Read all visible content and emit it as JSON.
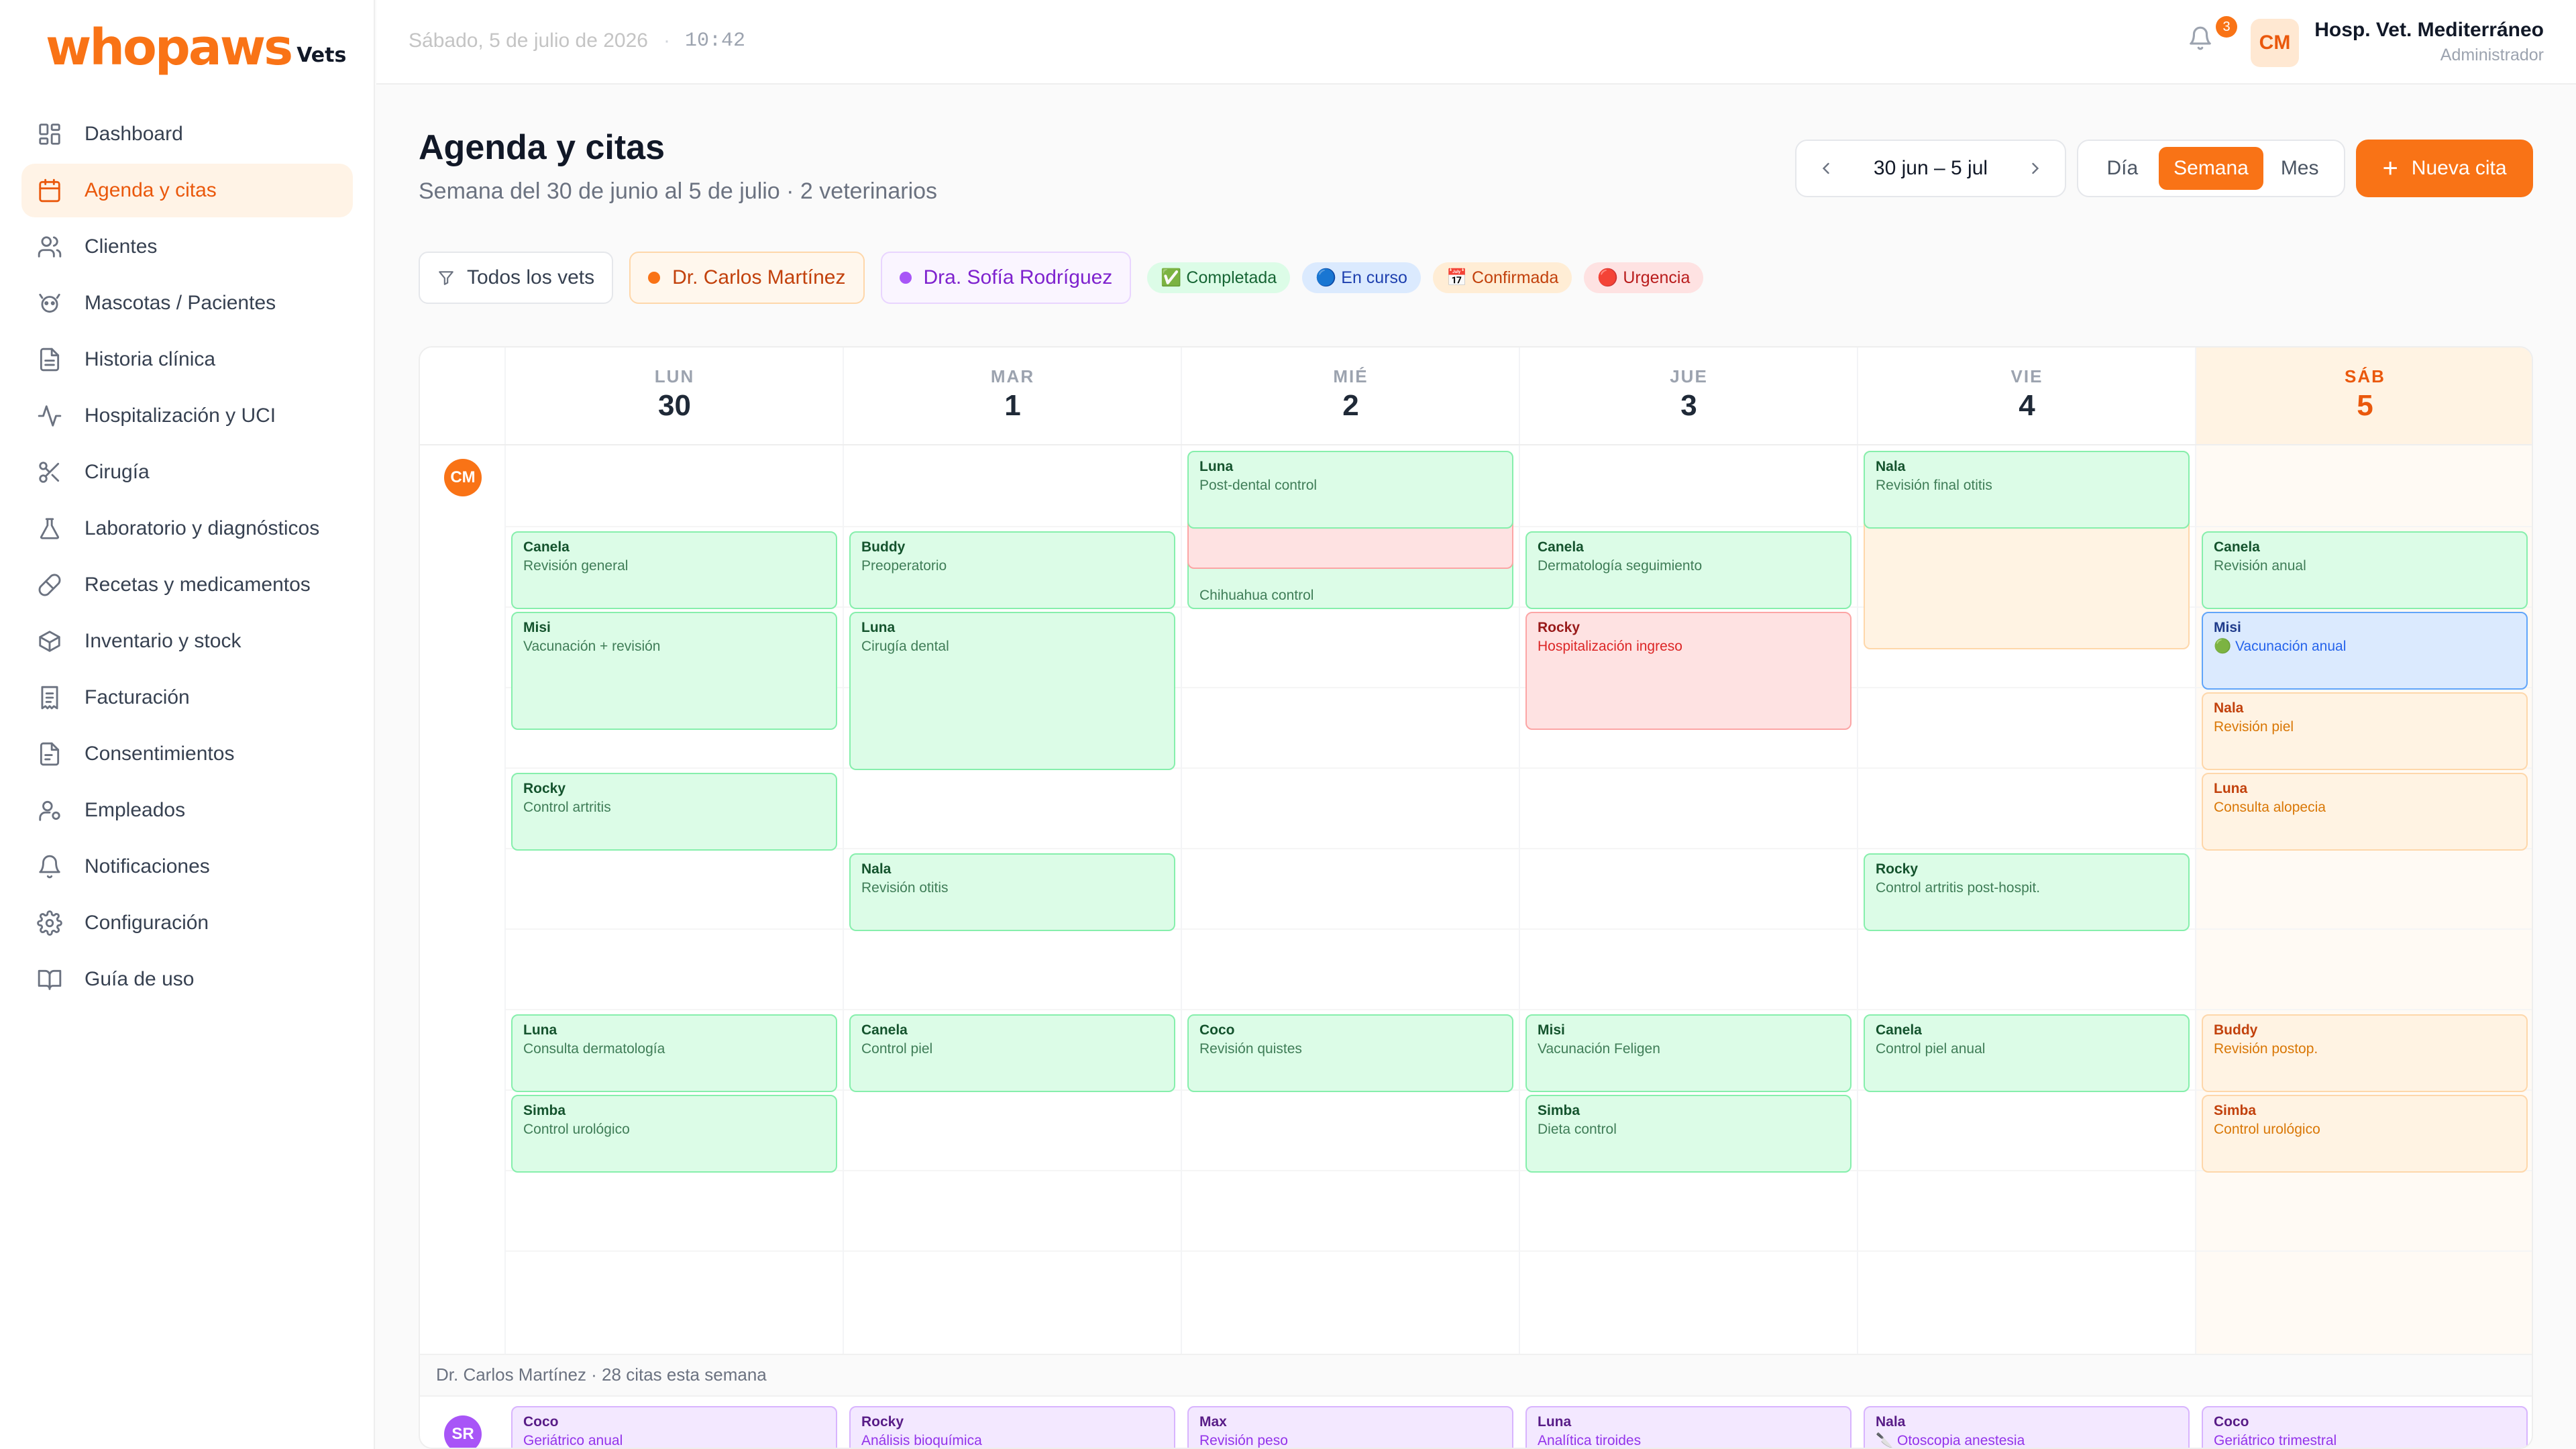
{
  "brand": {
    "name": "whopaws",
    "sub": "Vets",
    "accent": "#f97316"
  },
  "sidebar": {
    "items": [
      {
        "label": "Dashboard",
        "icon": "dashboard-icon",
        "active": false
      },
      {
        "label": "Agenda y citas",
        "icon": "calendar-icon",
        "active": true
      },
      {
        "label": "Clientes",
        "icon": "users-icon",
        "active": false
      },
      {
        "label": "Mascotas / Pacientes",
        "icon": "paw-icon",
        "active": false
      },
      {
        "label": "Historia clínica",
        "icon": "file-icon",
        "active": false
      },
      {
        "label": "Hospitalización y UCI",
        "icon": "pulse-icon",
        "active": false
      },
      {
        "label": "Cirugía",
        "icon": "scissors-icon",
        "active": false
      },
      {
        "label": "Laboratorio y diagnósticos",
        "icon": "flask-icon",
        "active": false
      },
      {
        "label": "Recetas y medicamentos",
        "icon": "pill-icon",
        "active": false
      },
      {
        "label": "Inventario y stock",
        "icon": "box-icon",
        "active": false
      },
      {
        "label": "Facturación",
        "icon": "receipt-icon",
        "active": false
      },
      {
        "label": "Consentimientos",
        "icon": "document-icon",
        "active": false
      },
      {
        "label": "Empleados",
        "icon": "employee-icon",
        "active": false
      },
      {
        "label": "Notificaciones",
        "icon": "bell-icon",
        "active": false
      },
      {
        "label": "Configuración",
        "icon": "gear-icon",
        "active": false
      },
      {
        "label": "Guía de uso",
        "icon": "book-icon",
        "active": false
      }
    ]
  },
  "topbar": {
    "date": "Sábado, 5 de julio de 2026",
    "separator": "·",
    "time": "10:42",
    "notifications_count": "3",
    "avatar": "CM",
    "org_name": "Hosp. Vet. Mediterráneo",
    "role": "Administrador"
  },
  "header": {
    "title": "Agenda y citas",
    "subtitle": "Semana del 30 de junio al 5 de julio · 2 veterinarios",
    "range": "30 jun – 5 jul",
    "views": [
      "Día",
      "Semana",
      "Mes"
    ],
    "active_view": "Semana",
    "new_button": "Nueva cita"
  },
  "filters": {
    "all": "Todos los vets",
    "vets": [
      {
        "name": "Dr. Carlos Martínez",
        "color": "#f97316"
      },
      {
        "name": "Dra. Sofía Rodríguez",
        "color": "#a855f7"
      }
    ],
    "legend": [
      {
        "label": "✅ Completada",
        "bg": "#dcfce7",
        "fg": "#166534"
      },
      {
        "label": "🔵 En curso",
        "bg": "#dbeafe",
        "fg": "#1e40af"
      },
      {
        "label": "📅 Confirmada",
        "bg": "#ffedd5",
        "fg": "#c2410c"
      },
      {
        "label": "🔴 Urgencia",
        "bg": "#fee2e2",
        "fg": "#b91c1c"
      }
    ]
  },
  "calendar": {
    "days": [
      {
        "dow": "LUN",
        "num": "30",
        "today": false
      },
      {
        "dow": "MAR",
        "num": "1",
        "today": false
      },
      {
        "dow": "MIÉ",
        "num": "2",
        "today": false
      },
      {
        "dow": "JUE",
        "num": "3",
        "today": false
      },
      {
        "dow": "VIE",
        "num": "4",
        "today": false
      },
      {
        "dow": "SÁB",
        "num": "5",
        "today": true
      }
    ],
    "vet1": {
      "avatar": "CM",
      "color": "#f97316",
      "summary": "Dr. Carlos Martínez · 28 citas esta semana",
      "appointments": [
        {
          "day": 0,
          "slot": 1,
          "span": 1,
          "pet": "Canela",
          "reason": "Revisión general",
          "status": "completada"
        },
        {
          "day": 0,
          "slot": 2,
          "span": 1.5,
          "pet": "Misi",
          "reason": "Vacunación + revisión",
          "status": "completada"
        },
        {
          "day": 0,
          "slot": 4,
          "span": 1,
          "pet": "Rocky",
          "reason": "Control artritis",
          "status": "completada"
        },
        {
          "day": 0,
          "slot": 7,
          "span": 1,
          "pet": "Luna",
          "reason": "Consulta dermatología",
          "status": "completada"
        },
        {
          "day": 0,
          "slot": 8,
          "span": 1,
          "pet": "Simba",
          "reason": "Control urológico",
          "status": "completada"
        },
        {
          "day": 1,
          "slot": 1,
          "span": 1,
          "pet": "Buddy",
          "reason": "Preoperatorio",
          "status": "completada"
        },
        {
          "day": 1,
          "slot": 2,
          "span": 2,
          "pet": "Luna",
          "reason": "Cirugía dental",
          "status": "completada"
        },
        {
          "day": 1,
          "slot": 5,
          "span": 1,
          "pet": "Nala",
          "reason": "Revisión otitis",
          "status": "completada"
        },
        {
          "day": 1,
          "slot": 7,
          "span": 1,
          "pet": "Canela",
          "reason": "Control piel",
          "status": "completada"
        },
        {
          "day": 2,
          "slot": 1,
          "span": 1,
          "pet": "",
          "reason": "Chihuahua control",
          "status": "completada"
        },
        {
          "day": 2,
          "slot": 0.5,
          "span": 1,
          "pet": "",
          "reason": "",
          "status": "urgencia"
        },
        {
          "day": 2,
          "slot": 0,
          "span": 1,
          "pet": "Luna",
          "reason": "Post-dental control",
          "status": "completada"
        },
        {
          "day": 2,
          "slot": 7,
          "span": 1,
          "pet": "Coco",
          "reason": "Revisión quistes",
          "status": "completada"
        },
        {
          "day": 3,
          "slot": 1,
          "span": 1,
          "pet": "Canela",
          "reason": "Dermatología seguimiento",
          "status": "completada"
        },
        {
          "day": 3,
          "slot": 2,
          "span": 1.5,
          "pet": "Rocky",
          "reason": "Hospitalización ingreso",
          "status": "urgencia"
        },
        {
          "day": 3,
          "slot": 7,
          "span": 1,
          "pet": "Misi",
          "reason": "Vacunación Feligen",
          "status": "completada"
        },
        {
          "day": 3,
          "slot": 8,
          "span": 1,
          "pet": "Simba",
          "reason": "Dieta control",
          "status": "completada"
        },
        {
          "day": 4,
          "slot": 0,
          "span": 2.5,
          "pet": "",
          "reason": "",
          "status": "confirmada"
        },
        {
          "day": 4,
          "slot": 0,
          "span": 1,
          "pet": "Nala",
          "reason": "Revisión final otitis",
          "status": "completada"
        },
        {
          "day": 4,
          "slot": 5,
          "span": 1,
          "pet": "Rocky",
          "reason": "Control artritis post-hospit.",
          "status": "completada"
        },
        {
          "day": 4,
          "slot": 7,
          "span": 1,
          "pet": "Canela",
          "reason": "Control piel anual",
          "status": "completada"
        },
        {
          "day": 5,
          "slot": 1,
          "span": 1,
          "pet": "Canela",
          "reason": "Revisión anual",
          "status": "completada"
        },
        {
          "day": 5,
          "slot": 2,
          "span": 1,
          "pet": "Misi",
          "reason": "🟢 Vacunación anual",
          "status": "encurso"
        },
        {
          "day": 5,
          "slot": 3,
          "span": 1,
          "pet": "Nala",
          "reason": "Revisión piel",
          "status": "confirmada"
        },
        {
          "day": 5,
          "slot": 4,
          "span": 1,
          "pet": "Luna",
          "reason": "Consulta alopecia",
          "status": "confirmada"
        },
        {
          "day": 5,
          "slot": 7,
          "span": 1,
          "pet": "Buddy",
          "reason": "Revisión postop.",
          "status": "confirmada"
        },
        {
          "day": 5,
          "slot": 8,
          "span": 1,
          "pet": "Simba",
          "reason": "Control urológico",
          "status": "confirmada"
        }
      ]
    },
    "vet2": {
      "avatar": "SR",
      "color": "#a855f7",
      "appointments": [
        {
          "day": 0,
          "pet": "Coco",
          "reason": "Geriátrico anual"
        },
        {
          "day": 1,
          "pet": "Rocky",
          "reason": "Análisis bioquímica"
        },
        {
          "day": 2,
          "pet": "Max",
          "reason": "Revisión peso"
        },
        {
          "day": 3,
          "pet": "Luna",
          "reason": "Analítica tiroides"
        },
        {
          "day": 4,
          "pet": "Nala",
          "reason": "🔪 Otoscopia anestesia"
        },
        {
          "day": 5,
          "pet": "Coco",
          "reason": "Geriátrico trimestral"
        }
      ]
    }
  }
}
